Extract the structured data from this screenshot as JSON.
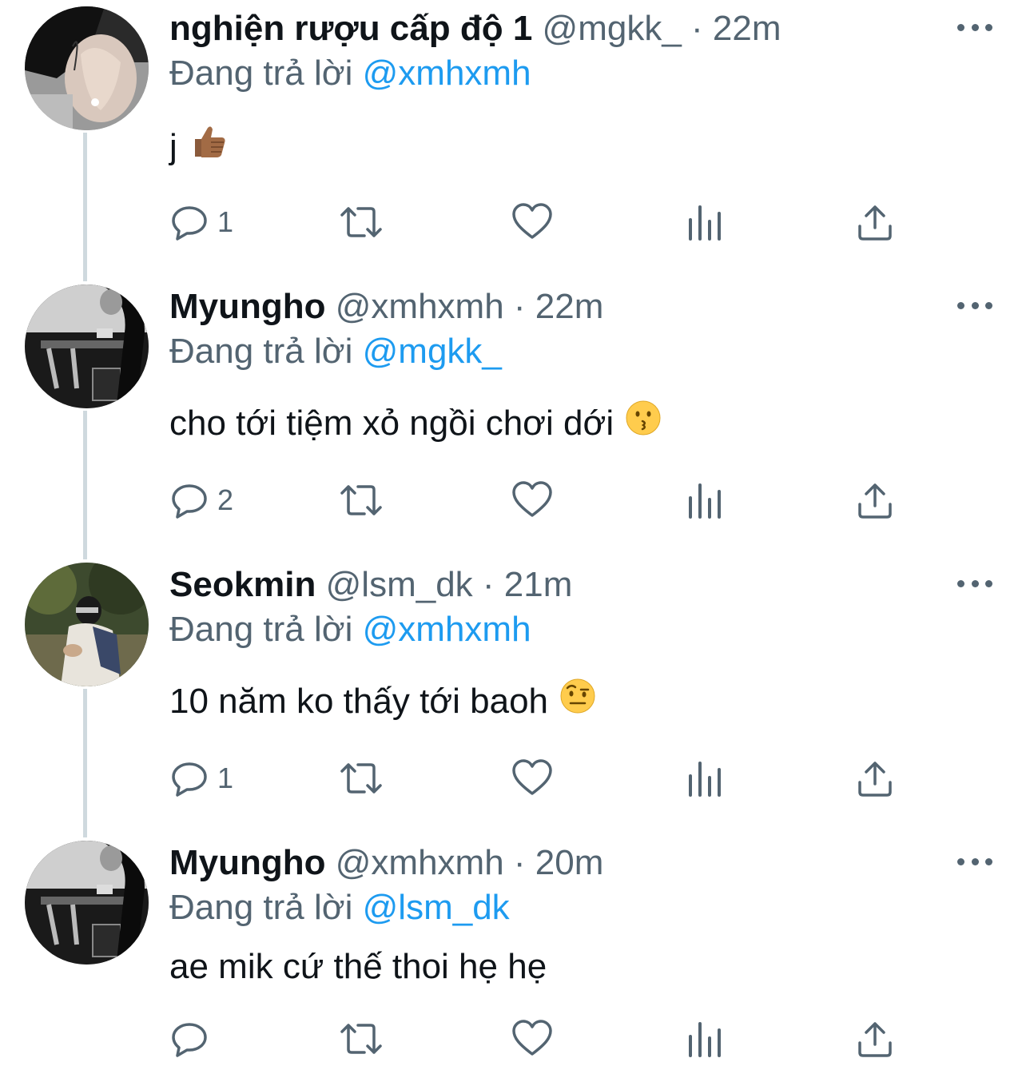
{
  "replies": [
    {
      "display_name": "nghiện rượu cấp độ 1",
      "handle": "@mgkk_",
      "time": "22m",
      "reply_label": "Đang trả lời",
      "reply_to": "@xmhxmh",
      "text": "j",
      "emoji": "thumbs-up-icon",
      "reply_count": "1"
    },
    {
      "display_name": "Myungho",
      "handle": "@xmhxmh",
      "time": "22m",
      "reply_label": "Đang trả lời",
      "reply_to": "@mgkk_",
      "text": "cho tới tiệm xỏ ngồi chơi dới",
      "emoji": "kissing-face-icon",
      "reply_count": "2"
    },
    {
      "display_name": "Seokmin",
      "handle": "@lsm_dk",
      "time": "21m",
      "reply_label": "Đang trả lời",
      "reply_to": "@xmhxmh",
      "text": "10 năm ko thấy tới baoh",
      "emoji": "raised-eyebrow-face-icon",
      "reply_count": "1"
    },
    {
      "display_name": "Myungho",
      "handle": "@xmhxmh",
      "time": "20m",
      "reply_label": "Đang trả lời",
      "reply_to": "@lsm_dk",
      "text": "ae mik cứ thế thoi hẹ hẹ",
      "emoji": "",
      "reply_count": ""
    }
  ],
  "separator": "·",
  "colors": {
    "text": "#0f1419",
    "secondary": "#536471",
    "link": "#1d9bf0",
    "thread_line": "#cfd9de"
  }
}
